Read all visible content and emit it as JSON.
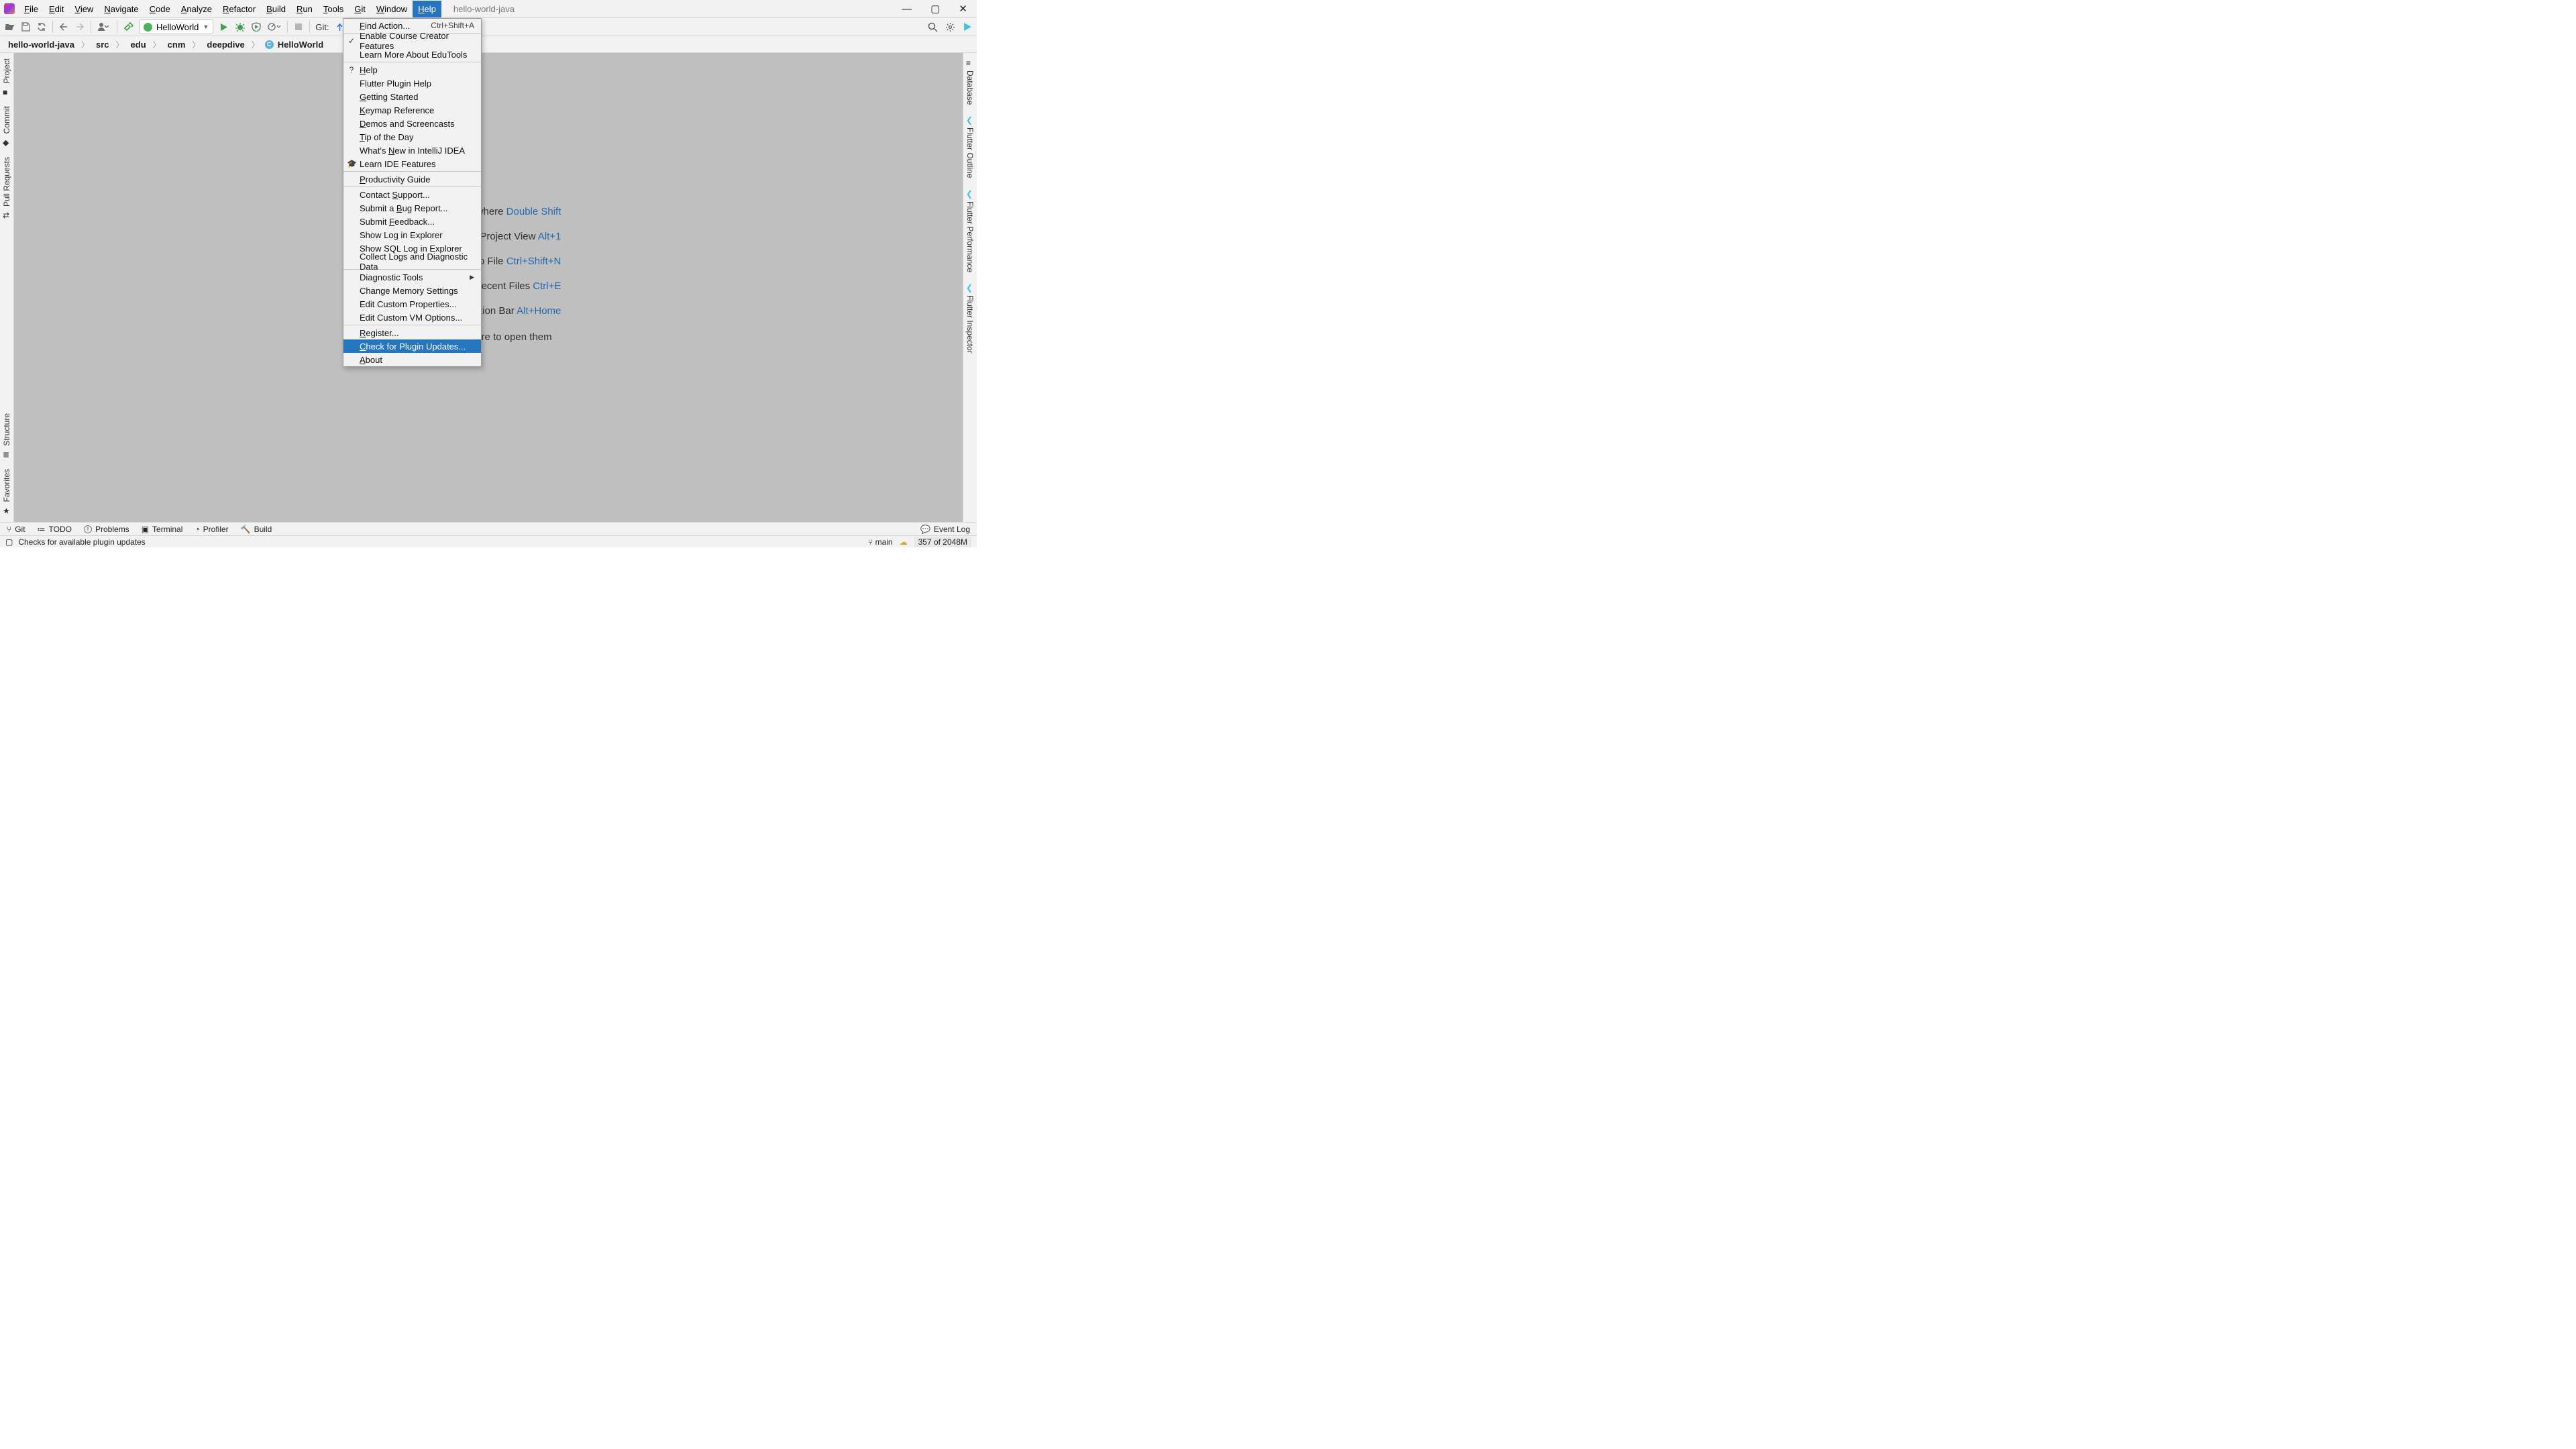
{
  "window": {
    "title": "hello-world-java"
  },
  "menubar": [
    "File",
    "Edit",
    "View",
    "Navigate",
    "Code",
    "Analyze",
    "Refactor",
    "Build",
    "Run",
    "Tools",
    "Git",
    "Window",
    "Help"
  ],
  "active_menu_index": 12,
  "toolbar": {
    "run_config": "HelloWorld",
    "git_label": "Git:"
  },
  "breadcrumb": [
    "hello-world-java",
    "src",
    "edu",
    "cnm",
    "deepdive",
    "HelloWorld"
  ],
  "left_panels": [
    "Project",
    "Commit",
    "Pull Requests",
    "Structure",
    "Favorites"
  ],
  "right_panels": [
    "Database",
    "Flutter Outline",
    "Flutter Performance",
    "Flutter Inspector"
  ],
  "hints": {
    "search_label": "Search Everywhere",
    "search_key": "Double Shift",
    "proj_label": "Project View",
    "proj_key": "Alt+1",
    "goto_label": "Go to File",
    "goto_key": "Ctrl+Shift+N",
    "recent_label": "Recent Files",
    "recent_key": "Ctrl+E",
    "nav_label": "Navigation Bar",
    "nav_key": "Alt+Home",
    "drop": "Drop files here to open them"
  },
  "help_menu": [
    {
      "t": "section",
      "items": [
        {
          "label": "Find Action...",
          "u": 0,
          "shortcut": "Ctrl+Shift+A"
        }
      ]
    },
    {
      "t": "section",
      "items": [
        {
          "label": "Enable Course Creator Features",
          "pre": "✓"
        },
        {
          "label": "Learn More About EduTools"
        }
      ]
    },
    {
      "t": "section",
      "items": [
        {
          "label": "Help",
          "u": 0,
          "pre": "?"
        },
        {
          "label": "Flutter Plugin Help"
        },
        {
          "label": "Getting Started",
          "u": 0
        },
        {
          "label": "Keymap Reference",
          "u": 0
        },
        {
          "label": "Demos and Screencasts",
          "u": 0
        },
        {
          "label": "Tip of the Day",
          "u": 0
        },
        {
          "label": "What's New in IntelliJ IDEA",
          "u": 7
        },
        {
          "label": "Learn IDE Features",
          "pre": "🎓"
        }
      ]
    },
    {
      "t": "section",
      "items": [
        {
          "label": "Productivity Guide",
          "u": 0
        }
      ]
    },
    {
      "t": "section",
      "items": [
        {
          "label": "Contact Support...",
          "u": 8
        },
        {
          "label": "Submit a Bug Report...",
          "u": 9
        },
        {
          "label": "Submit Feedback...",
          "u": 7
        },
        {
          "label": "Show Log in Explorer"
        },
        {
          "label": "Show SQL Log in Explorer"
        },
        {
          "label": "Collect Logs and Diagnostic Data"
        }
      ]
    },
    {
      "t": "section",
      "items": [
        {
          "label": "Diagnostic Tools",
          "submenu": true
        },
        {
          "label": "Change Memory Settings"
        },
        {
          "label": "Edit Custom Properties..."
        },
        {
          "label": "Edit Custom VM Options..."
        }
      ]
    },
    {
      "t": "section",
      "items": [
        {
          "label": "Register...",
          "u": 0
        },
        {
          "label": "Check for Plugin Updates...",
          "u": 0,
          "highlight": true
        },
        {
          "label": "About",
          "u": 0
        }
      ]
    }
  ],
  "bottom_tools": [
    "Git",
    "TODO",
    "Problems",
    "Terminal",
    "Profiler",
    "Build"
  ],
  "bottom_event": "Event Log",
  "status": {
    "hint": "Checks for available plugin updates",
    "branch": "main",
    "memory": "357 of 2048M"
  }
}
